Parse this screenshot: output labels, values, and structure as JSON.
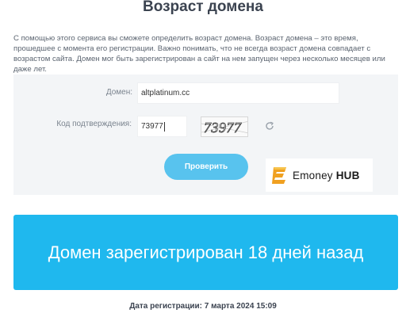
{
  "page": {
    "title": "Возраст домена",
    "description": "С помощью этого сервиса вы сможете определить возраст домена. Возраст домена – это время, прошедшее с момента его регистрации. Важно понимать, что не всегда возраст домена совпадает с возрастом сайта. Домен мог быть зарегистрирован а сайт на нем запущен через несколько месяцев или даже лет."
  },
  "form": {
    "domain_label": "Домен:",
    "domain_value": "altplatinum.cc",
    "code_label": "Код подтверждения:",
    "code_value": "73977",
    "captcha_text": "73977",
    "submit_label": "Проверить",
    "refresh_icon": "refresh-icon"
  },
  "watermark": {
    "brand_regular": "Emoney",
    "brand_bold": "HUB",
    "accent_color": "#f0a020"
  },
  "result": {
    "message": "Домен зарегистрирован 18 дней назад",
    "registration_date": "Дата регистрации: 7 марта 2024 15:09"
  },
  "colors": {
    "accent": "#1fb8ee",
    "button": "#58c3ee",
    "panel": "#f3f5f7"
  }
}
